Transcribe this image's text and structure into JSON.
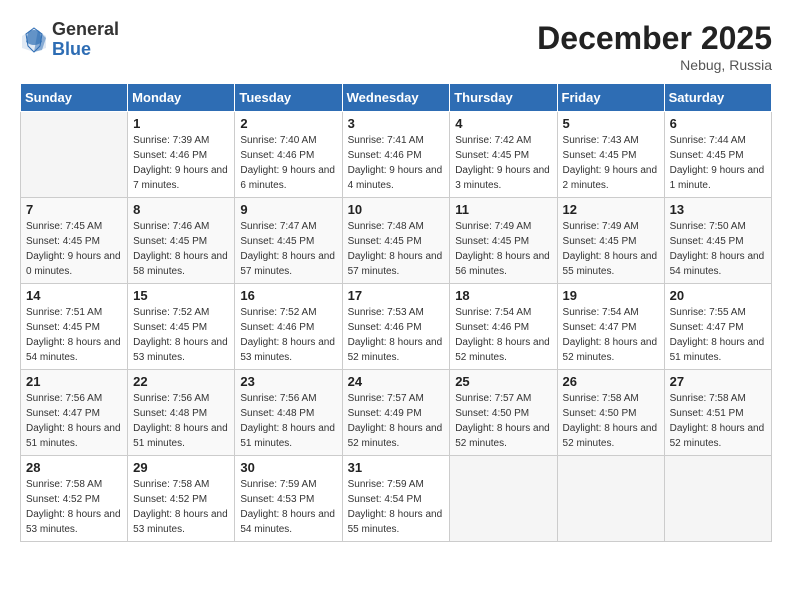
{
  "logo": {
    "general": "General",
    "blue": "Blue"
  },
  "title": "December 2025",
  "subtitle": "Nebug, Russia",
  "days_of_week": [
    "Sunday",
    "Monday",
    "Tuesday",
    "Wednesday",
    "Thursday",
    "Friday",
    "Saturday"
  ],
  "weeks": [
    [
      {
        "day": "",
        "sunrise": "",
        "sunset": "",
        "daylight": ""
      },
      {
        "day": "1",
        "sunrise": "Sunrise: 7:39 AM",
        "sunset": "Sunset: 4:46 PM",
        "daylight": "Daylight: 9 hours and 7 minutes."
      },
      {
        "day": "2",
        "sunrise": "Sunrise: 7:40 AM",
        "sunset": "Sunset: 4:46 PM",
        "daylight": "Daylight: 9 hours and 6 minutes."
      },
      {
        "day": "3",
        "sunrise": "Sunrise: 7:41 AM",
        "sunset": "Sunset: 4:46 PM",
        "daylight": "Daylight: 9 hours and 4 minutes."
      },
      {
        "day": "4",
        "sunrise": "Sunrise: 7:42 AM",
        "sunset": "Sunset: 4:45 PM",
        "daylight": "Daylight: 9 hours and 3 minutes."
      },
      {
        "day": "5",
        "sunrise": "Sunrise: 7:43 AM",
        "sunset": "Sunset: 4:45 PM",
        "daylight": "Daylight: 9 hours and 2 minutes."
      },
      {
        "day": "6",
        "sunrise": "Sunrise: 7:44 AM",
        "sunset": "Sunset: 4:45 PM",
        "daylight": "Daylight: 9 hours and 1 minute."
      }
    ],
    [
      {
        "day": "7",
        "sunrise": "Sunrise: 7:45 AM",
        "sunset": "Sunset: 4:45 PM",
        "daylight": "Daylight: 9 hours and 0 minutes."
      },
      {
        "day": "8",
        "sunrise": "Sunrise: 7:46 AM",
        "sunset": "Sunset: 4:45 PM",
        "daylight": "Daylight: 8 hours and 58 minutes."
      },
      {
        "day": "9",
        "sunrise": "Sunrise: 7:47 AM",
        "sunset": "Sunset: 4:45 PM",
        "daylight": "Daylight: 8 hours and 57 minutes."
      },
      {
        "day": "10",
        "sunrise": "Sunrise: 7:48 AM",
        "sunset": "Sunset: 4:45 PM",
        "daylight": "Daylight: 8 hours and 57 minutes."
      },
      {
        "day": "11",
        "sunrise": "Sunrise: 7:49 AM",
        "sunset": "Sunset: 4:45 PM",
        "daylight": "Daylight: 8 hours and 56 minutes."
      },
      {
        "day": "12",
        "sunrise": "Sunrise: 7:49 AM",
        "sunset": "Sunset: 4:45 PM",
        "daylight": "Daylight: 8 hours and 55 minutes."
      },
      {
        "day": "13",
        "sunrise": "Sunrise: 7:50 AM",
        "sunset": "Sunset: 4:45 PM",
        "daylight": "Daylight: 8 hours and 54 minutes."
      }
    ],
    [
      {
        "day": "14",
        "sunrise": "Sunrise: 7:51 AM",
        "sunset": "Sunset: 4:45 PM",
        "daylight": "Daylight: 8 hours and 54 minutes."
      },
      {
        "day": "15",
        "sunrise": "Sunrise: 7:52 AM",
        "sunset": "Sunset: 4:45 PM",
        "daylight": "Daylight: 8 hours and 53 minutes."
      },
      {
        "day": "16",
        "sunrise": "Sunrise: 7:52 AM",
        "sunset": "Sunset: 4:46 PM",
        "daylight": "Daylight: 8 hours and 53 minutes."
      },
      {
        "day": "17",
        "sunrise": "Sunrise: 7:53 AM",
        "sunset": "Sunset: 4:46 PM",
        "daylight": "Daylight: 8 hours and 52 minutes."
      },
      {
        "day": "18",
        "sunrise": "Sunrise: 7:54 AM",
        "sunset": "Sunset: 4:46 PM",
        "daylight": "Daylight: 8 hours and 52 minutes."
      },
      {
        "day": "19",
        "sunrise": "Sunrise: 7:54 AM",
        "sunset": "Sunset: 4:47 PM",
        "daylight": "Daylight: 8 hours and 52 minutes."
      },
      {
        "day": "20",
        "sunrise": "Sunrise: 7:55 AM",
        "sunset": "Sunset: 4:47 PM",
        "daylight": "Daylight: 8 hours and 51 minutes."
      }
    ],
    [
      {
        "day": "21",
        "sunrise": "Sunrise: 7:56 AM",
        "sunset": "Sunset: 4:47 PM",
        "daylight": "Daylight: 8 hours and 51 minutes."
      },
      {
        "day": "22",
        "sunrise": "Sunrise: 7:56 AM",
        "sunset": "Sunset: 4:48 PM",
        "daylight": "Daylight: 8 hours and 51 minutes."
      },
      {
        "day": "23",
        "sunrise": "Sunrise: 7:56 AM",
        "sunset": "Sunset: 4:48 PM",
        "daylight": "Daylight: 8 hours and 51 minutes."
      },
      {
        "day": "24",
        "sunrise": "Sunrise: 7:57 AM",
        "sunset": "Sunset: 4:49 PM",
        "daylight": "Daylight: 8 hours and 52 minutes."
      },
      {
        "day": "25",
        "sunrise": "Sunrise: 7:57 AM",
        "sunset": "Sunset: 4:50 PM",
        "daylight": "Daylight: 8 hours and 52 minutes."
      },
      {
        "day": "26",
        "sunrise": "Sunrise: 7:58 AM",
        "sunset": "Sunset: 4:50 PM",
        "daylight": "Daylight: 8 hours and 52 minutes."
      },
      {
        "day": "27",
        "sunrise": "Sunrise: 7:58 AM",
        "sunset": "Sunset: 4:51 PM",
        "daylight": "Daylight: 8 hours and 52 minutes."
      }
    ],
    [
      {
        "day": "28",
        "sunrise": "Sunrise: 7:58 AM",
        "sunset": "Sunset: 4:52 PM",
        "daylight": "Daylight: 8 hours and 53 minutes."
      },
      {
        "day": "29",
        "sunrise": "Sunrise: 7:58 AM",
        "sunset": "Sunset: 4:52 PM",
        "daylight": "Daylight: 8 hours and 53 minutes."
      },
      {
        "day": "30",
        "sunrise": "Sunrise: 7:59 AM",
        "sunset": "Sunset: 4:53 PM",
        "daylight": "Daylight: 8 hours and 54 minutes."
      },
      {
        "day": "31",
        "sunrise": "Sunrise: 7:59 AM",
        "sunset": "Sunset: 4:54 PM",
        "daylight": "Daylight: 8 hours and 55 minutes."
      },
      {
        "day": "",
        "sunrise": "",
        "sunset": "",
        "daylight": ""
      },
      {
        "day": "",
        "sunrise": "",
        "sunset": "",
        "daylight": ""
      },
      {
        "day": "",
        "sunrise": "",
        "sunset": "",
        "daylight": ""
      }
    ]
  ]
}
